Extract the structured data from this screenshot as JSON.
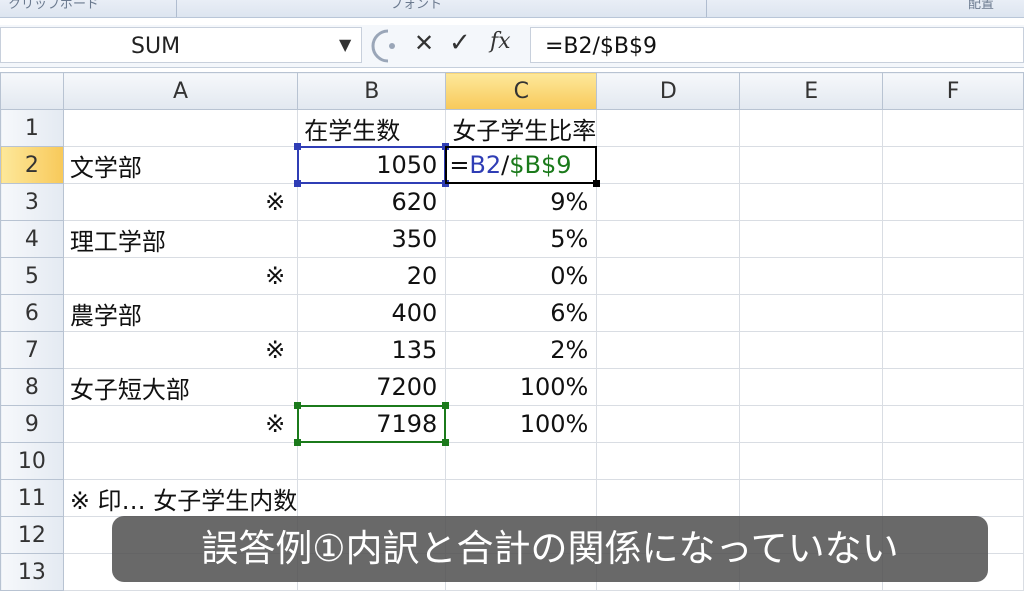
{
  "ribbon": {
    "group1": "クリップボード",
    "group2": "フォント",
    "group3": "配置"
  },
  "namebox": {
    "value": "SUM"
  },
  "formula_bar": {
    "cancel": "✕",
    "enter": "✓",
    "fx": "fx",
    "formula": "=B2/$B$9"
  },
  "columns": [
    "A",
    "B",
    "C",
    "D",
    "E",
    "F"
  ],
  "rows": [
    {
      "n": "1",
      "a": "",
      "b": "在学生数",
      "c": "女子学生比率"
    },
    {
      "n": "2",
      "a": "文学部",
      "b": "1050",
      "c_parts": [
        "=",
        "B2",
        "/",
        "$B$9"
      ]
    },
    {
      "n": "3",
      "a": "※",
      "b": "620",
      "c": "9%"
    },
    {
      "n": "4",
      "a": "理工学部",
      "b": "350",
      "c": "5%"
    },
    {
      "n": "5",
      "a": "※",
      "b": "20",
      "c": "0%"
    },
    {
      "n": "6",
      "a": "農学部",
      "b": "400",
      "c": "6%"
    },
    {
      "n": "7",
      "a": "※",
      "b": "135",
      "c": "2%"
    },
    {
      "n": "8",
      "a": "女子短大部",
      "b": "7200",
      "c": "100%"
    },
    {
      "n": "9",
      "a": "※",
      "b": "7198",
      "c": "100%"
    },
    {
      "n": "10",
      "a": "",
      "b": "",
      "c": ""
    },
    {
      "n": "11",
      "a": "※ 印… 女子学生内数",
      "b": "",
      "c": ""
    },
    {
      "n": "12",
      "a": "",
      "b": "",
      "c": ""
    },
    {
      "n": "13",
      "a": "",
      "b": "",
      "c": ""
    }
  ],
  "caption": "誤答例①内訳と合計の関係になっていない",
  "colors": {
    "ref_blue": "#2f3db5",
    "ref_green": "#1b7a1b",
    "active_header": "#f8c95a"
  }
}
